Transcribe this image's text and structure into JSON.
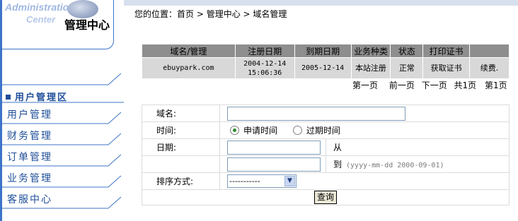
{
  "logo": {
    "en_line1": "Administratio",
    "en_line2": "Center",
    "cn": "管理中心"
  },
  "sidebar": {
    "zone_title": "用户管理区",
    "items": [
      {
        "label": "用户管理"
      },
      {
        "label": "财务管理"
      },
      {
        "label": "订单管理"
      },
      {
        "label": "业务管理"
      },
      {
        "label": "客服中心"
      }
    ]
  },
  "breadcrumb": {
    "prefix": "您的位置：",
    "home": "首页",
    "sep1": " > ",
    "center": "管理中心",
    "sep2": " > ",
    "current": "域名管理"
  },
  "result_table": {
    "headers": [
      "域名/管理",
      "注册日期",
      "到期日期",
      "业务种类",
      "状态",
      "打印证书",
      ""
    ],
    "row": {
      "domain": "ebuypark.com",
      "reg_date": "2004-12-14",
      "reg_time": "15:06:36",
      "expire_date": "2005-12-14",
      "business": "本站注册",
      "status": "正常",
      "certificate": "获取证书",
      "renew": "续费."
    }
  },
  "pager": {
    "first": "第一页",
    "prev": "前一页",
    "next": "下一页",
    "total": "共1页",
    "current": "第1页"
  },
  "search": {
    "domain_label": "域名:",
    "domain_value": "",
    "time_label": "时间:",
    "radio_apply": "申请时间",
    "radio_expire": "过期时间",
    "date_label": "日期:",
    "date_from_value": "",
    "from_text": "从",
    "date_to_value": "",
    "to_text": "到",
    "to_hint": "(yyyy-mm-dd 2000-09-01)",
    "sort_label": "排序方式:",
    "sort_selected": "-----------",
    "submit_label": "查询"
  }
}
